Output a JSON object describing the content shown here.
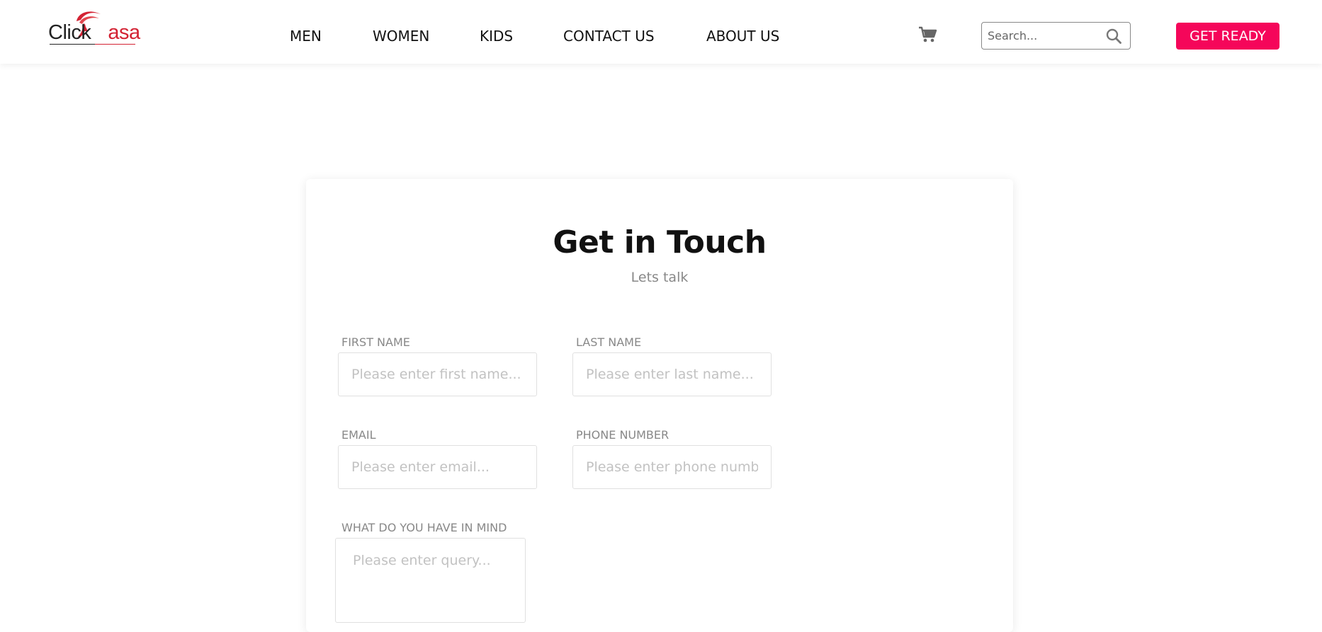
{
  "brand": {
    "logo_text_a": "Click",
    "logo_text_b": "asa",
    "logo_color_red": "#d32233"
  },
  "nav": {
    "items": [
      {
        "label": "MEN"
      },
      {
        "label": "WOMEN"
      },
      {
        "label": "KIDS"
      },
      {
        "label": "CONTACT US"
      },
      {
        "label": "ABOUT US"
      }
    ]
  },
  "header": {
    "cart_icon": "shopping-cart-icon",
    "search_placeholder": "Search...",
    "search_icon": "search-icon",
    "cta_label": "GET READY",
    "cta_color": "#f5065a"
  },
  "contact": {
    "title": "Get in Touch",
    "subtitle": "Lets talk",
    "fields": {
      "first_name": {
        "label": "FIRST NAME",
        "placeholder": "Please enter first name..."
      },
      "last_name": {
        "label": "LAST NAME",
        "placeholder": "Please enter last name..."
      },
      "email": {
        "label": "EMAIL",
        "placeholder": "Please enter email..."
      },
      "phone": {
        "label": "PHONE NUMBER",
        "placeholder": "Please enter phone number..."
      },
      "query": {
        "label": "WHAT DO YOU HAVE IN MIND",
        "placeholder": "Please enter query..."
      }
    }
  }
}
